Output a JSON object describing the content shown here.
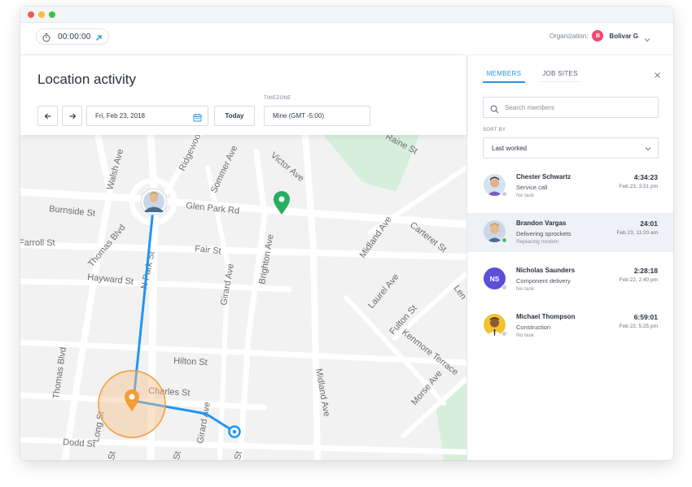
{
  "timer": {
    "value": "00:00:00"
  },
  "organization": {
    "label": "Organization:",
    "initial": "B",
    "name": "Bolivar G"
  },
  "page": {
    "title": "Location activity"
  },
  "controls": {
    "date": "Fri, Feb 23, 2018",
    "today_label": "Today",
    "timezone_label": "TIMEZONE",
    "timezone_value": "Mine (GMT -5:00)"
  },
  "map": {
    "streets": [
      "Raine St",
      "Walsh Ave",
      "Ridgewood",
      "Sommer Ave",
      "Victor Ave",
      "Burnside St",
      "Glen Park Rd",
      "Thomas Blvd",
      "N Park St",
      "Carteret St",
      "Midland Ave",
      "Farroll St",
      "Fair St",
      "Hayward St",
      "Girard Ave",
      "Brighton Ave",
      "Laurel Ave",
      "Fulton St",
      "Len",
      "Kenmore Terrace",
      "Thomas Blvd",
      "Hilton St",
      "Charles St",
      "Morse Ave",
      "Long St",
      "Girard Ave",
      "Dodd St",
      "Midland Ave",
      "St",
      "St",
      "St"
    ],
    "colors": {
      "route": "#2196f3",
      "marker_green": "#27ae60",
      "marker_orange": "#f39c38"
    }
  },
  "sidebar": {
    "tabs": [
      "MEMBERS",
      "JOB SITES"
    ],
    "search_placeholder": "Search members",
    "sort_label": "SORT BY",
    "sort_value": "Last worked",
    "members": [
      {
        "name": "Chester Schwartz",
        "task": "Service call",
        "subtask": "No task",
        "duration": "4:34:23",
        "when": "Feb 23, 3:31 pm",
        "status": "offline",
        "avatar": "photo"
      },
      {
        "name": "Brandon Vargas",
        "task": "Delivering sprockets",
        "subtask": "Replacing modem",
        "duration": "24:01",
        "when": "Feb 23, 11:20 am",
        "status": "online",
        "avatar": "photo"
      },
      {
        "name": "Nicholas Saunders",
        "task": "Component delivery",
        "subtask": "No task",
        "duration": "2:28:18",
        "when": "Feb 22, 2:40 pm",
        "status": "offline",
        "avatar": "initials",
        "initials": "NS"
      },
      {
        "name": "Michael Thompson",
        "task": "Construction",
        "subtask": "No task",
        "duration": "6:59:01",
        "when": "Feb 22, 5:25 pm",
        "status": "offline",
        "avatar": "photo"
      }
    ]
  }
}
